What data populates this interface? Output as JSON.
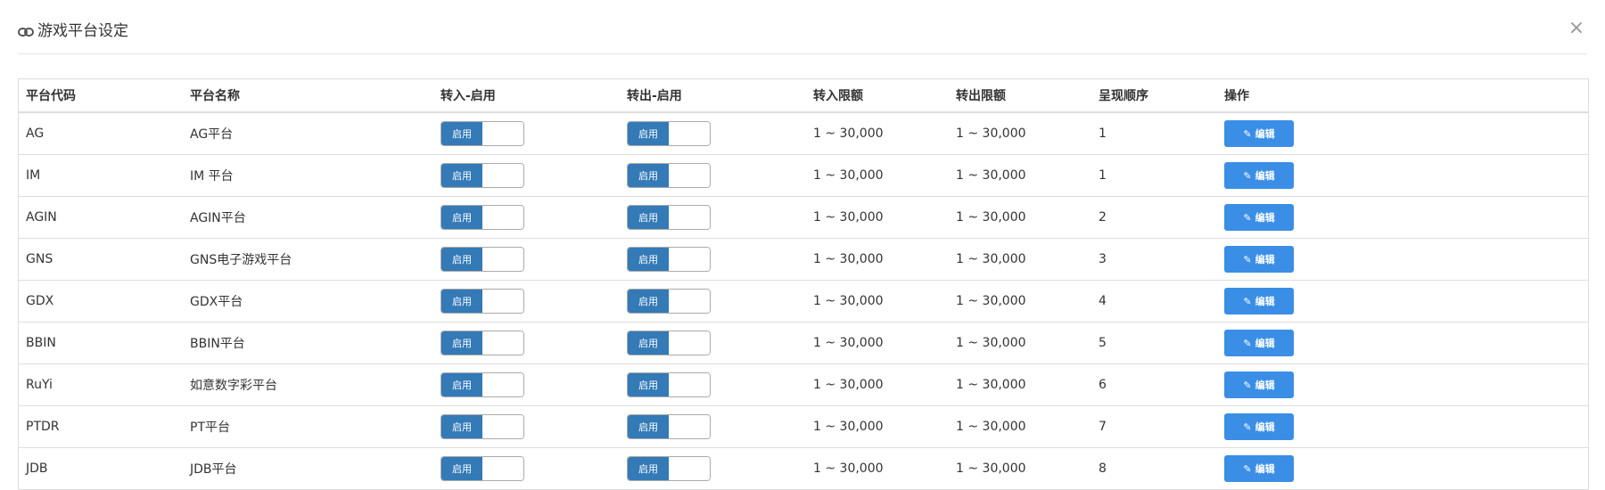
{
  "modal": {
    "title": "游戏平台设定",
    "title_icon": "link-icon",
    "close_label": "×"
  },
  "table": {
    "headers": [
      "平台代码",
      "平台名称",
      "转入-启用",
      "转出-启用",
      "转入限额",
      "转出限额",
      "呈现顺序",
      "操作"
    ],
    "switch_on_label": "启用",
    "edit_label": "编辑",
    "edit_icon_glyph": "✎",
    "rows": [
      {
        "code": "AG",
        "name": "AG平台",
        "in_enabled": true,
        "out_enabled": true,
        "in_limit": "1 ~ 30,000",
        "out_limit": "1 ~ 30,000",
        "order": "1"
      },
      {
        "code": "IM",
        "name": "IM 平台",
        "in_enabled": true,
        "out_enabled": true,
        "in_limit": "1 ~ 30,000",
        "out_limit": "1 ~ 30,000",
        "order": "1"
      },
      {
        "code": "AGIN",
        "name": "AGIN平台",
        "in_enabled": true,
        "out_enabled": true,
        "in_limit": "1 ~ 30,000",
        "out_limit": "1 ~ 30,000",
        "order": "2"
      },
      {
        "code": "GNS",
        "name": "GNS电子游戏平台",
        "in_enabled": true,
        "out_enabled": true,
        "in_limit": "1 ~ 30,000",
        "out_limit": "1 ~ 30,000",
        "order": "3"
      },
      {
        "code": "GDX",
        "name": "GDX平台",
        "in_enabled": true,
        "out_enabled": true,
        "in_limit": "1 ~ 30,000",
        "out_limit": "1 ~ 30,000",
        "order": "4"
      },
      {
        "code": "BBIN",
        "name": "BBIN平台",
        "in_enabled": true,
        "out_enabled": true,
        "in_limit": "1 ~ 30,000",
        "out_limit": "1 ~ 30,000",
        "order": "5"
      },
      {
        "code": "RuYi",
        "name": "如意数字彩平台",
        "in_enabled": true,
        "out_enabled": true,
        "in_limit": "1 ~ 30,000",
        "out_limit": "1 ~ 30,000",
        "order": "6"
      },
      {
        "code": "PTDR",
        "name": "PT平台",
        "in_enabled": true,
        "out_enabled": true,
        "in_limit": "1 ~ 30,000",
        "out_limit": "1 ~ 30,000",
        "order": "7"
      },
      {
        "code": "JDB",
        "name": "JDB平台",
        "in_enabled": true,
        "out_enabled": true,
        "in_limit": "1 ~ 30,000",
        "out_limit": "1 ~ 30,000",
        "order": "8"
      }
    ]
  },
  "colors": {
    "switch_on": "#337ab7",
    "edit_button": "#3a8ee6"
  }
}
